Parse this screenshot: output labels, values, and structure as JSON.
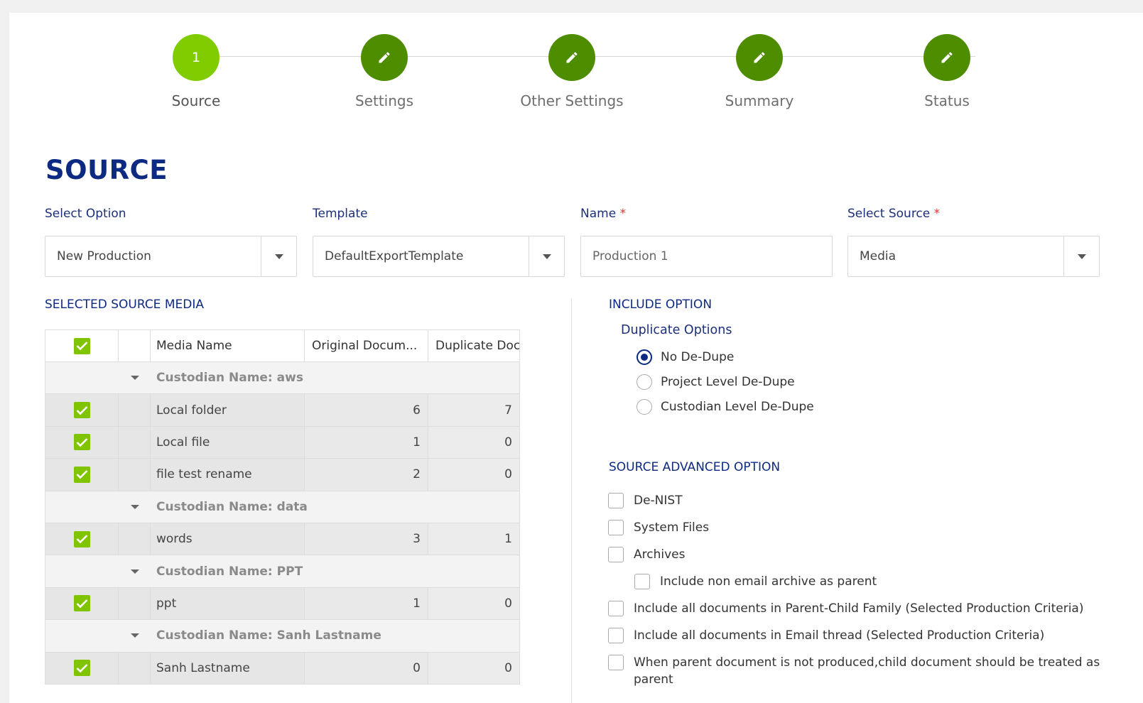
{
  "stepper": {
    "steps": [
      {
        "label": "Source",
        "marker": "1",
        "state": "active"
      },
      {
        "label": "Settings",
        "marker": "pencil-icon",
        "state": "done"
      },
      {
        "label": "Other Settings",
        "marker": "pencil-icon",
        "state": "done"
      },
      {
        "label": "Summary",
        "marker": "pencil-icon",
        "state": "done"
      },
      {
        "label": "Status",
        "marker": "pencil-icon",
        "state": "done"
      }
    ]
  },
  "page": {
    "title": "SOURCE"
  },
  "fields": {
    "select_option": {
      "label": "Select Option",
      "value": "New Production"
    },
    "template": {
      "label": "Template",
      "value": "DefaultExportTemplate"
    },
    "name": {
      "label": "Name",
      "required": "*",
      "value": "Production 1"
    },
    "select_source": {
      "label": "Select Source",
      "required": "*",
      "value": "Media"
    }
  },
  "source_media": {
    "title": "SELECTED SOURCE MEDIA",
    "columns": [
      "Media Name",
      "Original Docum...",
      "Duplicate Docu..."
    ],
    "groups": [
      {
        "label": "Custodian Name: aws",
        "rows": [
          {
            "name": "Local folder",
            "original": "6",
            "duplicate": "7"
          },
          {
            "name": "Local file",
            "original": "1",
            "duplicate": "0"
          },
          {
            "name": "file test rename",
            "original": "2",
            "duplicate": "0"
          }
        ]
      },
      {
        "label": "Custodian Name: data",
        "rows": [
          {
            "name": "words",
            "original": "3",
            "duplicate": "1"
          }
        ]
      },
      {
        "label": "Custodian Name: PPT",
        "rows": [
          {
            "name": "ppt",
            "original": "1",
            "duplicate": "0"
          }
        ]
      },
      {
        "label": "Custodian Name: Sanh Lastname",
        "rows": [
          {
            "name": "Sanh Lastname",
            "original": "0",
            "duplicate": "0"
          }
        ]
      }
    ]
  },
  "include_option": {
    "title": "INCLUDE OPTION",
    "subtitle": "Duplicate Options",
    "radios": [
      "No De-Dupe",
      "Project Level De-Dupe",
      "Custodian Level De-Dupe"
    ],
    "selected": "No De-Dupe"
  },
  "advanced": {
    "title": "SOURCE ADVANCED OPTION",
    "options": [
      "De-NIST",
      "System Files",
      "Archives",
      "Include non email archive as parent",
      "Include all documents in Parent-Child Family (Selected Production Criteria)",
      "Include all documents in Email thread (Selected Production Criteria)",
      "When parent document is not produced,child document should be treated as parent"
    ]
  },
  "colors": {
    "accent": "#0d2a82",
    "active_step": "#80cc00",
    "done_step": "#4f8d00",
    "checkbox": "#80c400"
  }
}
